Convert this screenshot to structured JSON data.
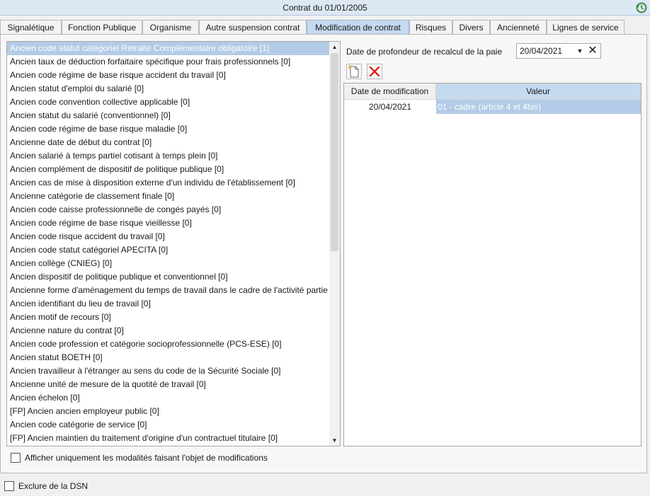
{
  "window": {
    "title": "Contrat du 01/01/2005"
  },
  "tabs": [
    {
      "label": "Signalétique",
      "active": false
    },
    {
      "label": "Fonction Publique",
      "active": false
    },
    {
      "label": "Organisme",
      "active": false
    },
    {
      "label": "Autre suspension contrat",
      "active": false
    },
    {
      "label": "Modification de contrat",
      "active": true
    },
    {
      "label": "Risques",
      "active": false
    },
    {
      "label": "Divers",
      "active": false
    },
    {
      "label": "Ancienneté",
      "active": false
    },
    {
      "label": "Lignes de service",
      "active": false
    }
  ],
  "list": {
    "items": [
      "Ancien code statut catégoriel Retraite Complémentaire obligatoire [1]",
      "Ancien taux de déduction forfaitaire spécifique pour frais professionnels [0]",
      "Ancien code régime de base risque accident du travail [0]",
      "Ancien statut d'emploi du salarié [0]",
      "Ancien code convention collective applicable [0]",
      "Ancien statut du salarié (conventionnel) [0]",
      "Ancien code régime de base risque maladie [0]",
      "Ancienne date de début du contrat [0]",
      "Ancien salarié à temps partiel cotisant à temps plein [0]",
      "Ancien complément de dispositif de politique publique [0]",
      "Ancien cas de mise à disposition externe d'un individu de l'établissement [0]",
      "Ancienne catégorie de classement finale [0]",
      "Ancien code caisse professionnelle de congés payés [0]",
      "Ancien code régime de base risque vieillesse [0]",
      "Ancien code risque accident du travail [0]",
      "Ancien code statut catégoriel APECITA [0]",
      "Ancien collège (CNIEG) [0]",
      "Ancien dispositif de politique publique et conventionnel [0]",
      "Ancienne forme d'aménagement du temps de travail dans le cadre de l'activité partie",
      "Ancien identifiant du lieu de travail [0]",
      "Ancien motif de recours [0]",
      "Ancienne nature du contrat [0]",
      "Ancien code profession et catégorie socioprofessionnelle (PCS-ESE) [0]",
      "Ancien statut BOETH [0]",
      "Ancien travailleur à l'étranger au sens du code de la Sécurité Sociale [0]",
      "Ancienne unité de mesure de la quotité de travail [0]",
      "Ancien échelon [0]",
      "[FP] Ancien ancien employeur public [0]",
      "Ancien code catégorie de service [0]",
      "[FP] Ancien maintien du traitement d'origine d'un contractuel titulaire [0]"
    ],
    "selected_index": 0
  },
  "filter": {
    "label": "Afficher uniquement les modalités faisant l'objet de modifications",
    "checked": false
  },
  "recalc": {
    "label": "Date de profondeur de recalcul de la paie",
    "value": "20/04/2021"
  },
  "grid": {
    "headers": {
      "date": "Date de modification",
      "value": "Valeur"
    },
    "rows": [
      {
        "date": "20/04/2021",
        "value": "01 - cadre (article 4 et 4bis)"
      }
    ]
  },
  "footer": {
    "label": "Exclure de la DSN",
    "checked": false
  },
  "colors": {
    "tab_active": "#c5d9ef",
    "selection": "#b3cbe6",
    "delete_red": "#e02020"
  }
}
